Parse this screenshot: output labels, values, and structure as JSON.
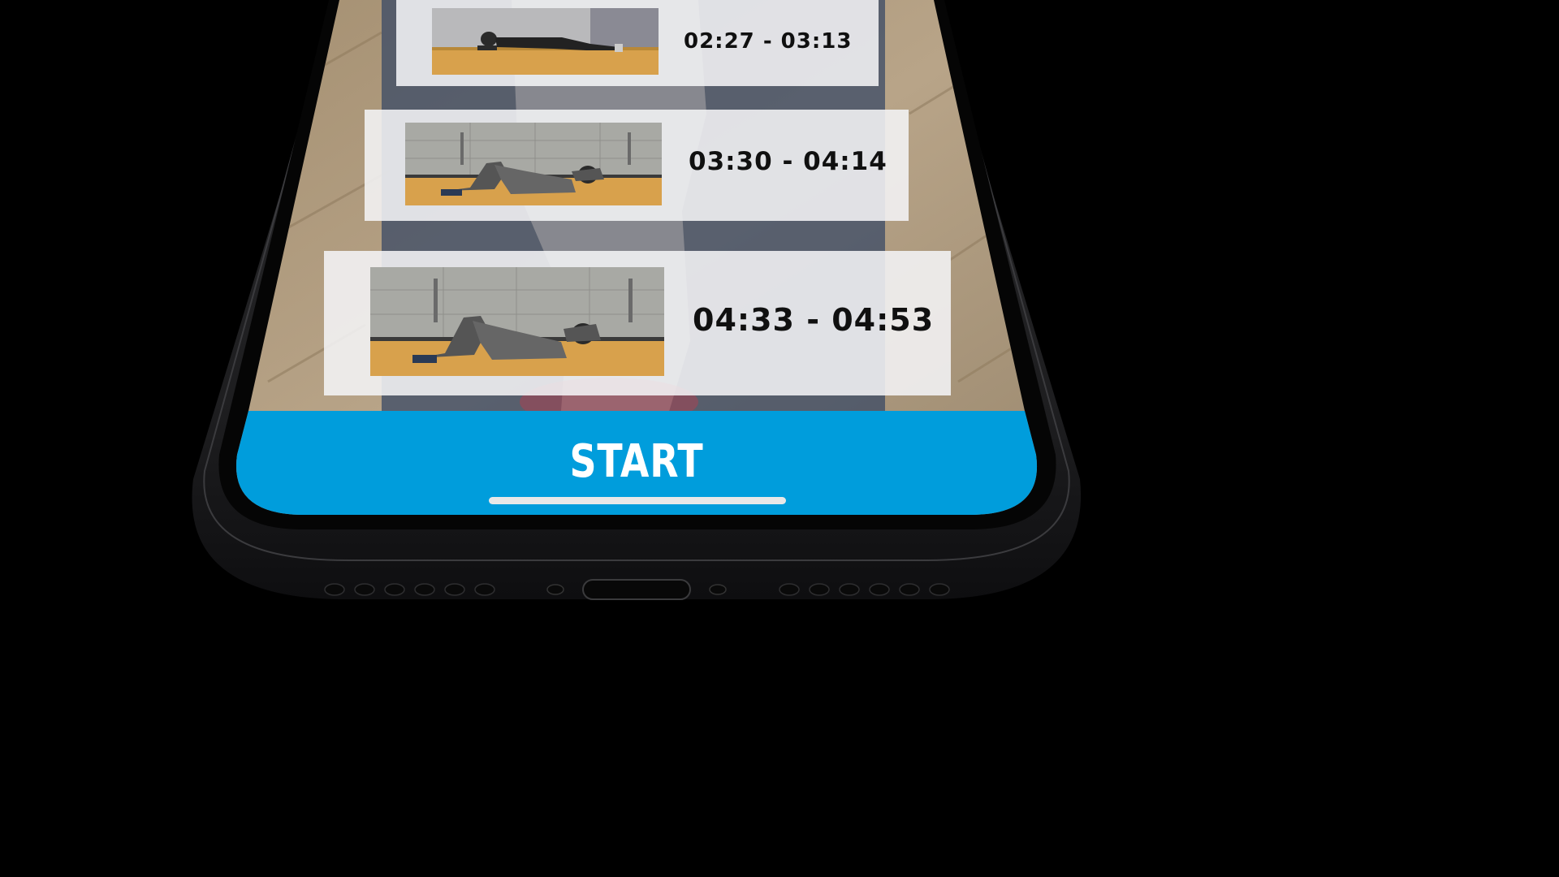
{
  "colors": {
    "accent": "#009ddc",
    "phone_body": "#1c1c1e",
    "card_bg": "#f4f4f6",
    "floor": "#d9a859"
  },
  "exercises": [
    {
      "time_range": "02:27 - 03:13",
      "thumbnail": "plank-exercise-image"
    },
    {
      "time_range": "03:30 - 04:14",
      "thumbnail": "crunch-exercise-image"
    },
    {
      "time_range": "04:33 - 04:53",
      "thumbnail": "crunch-exercise-image"
    }
  ],
  "start_button": {
    "label": "START"
  }
}
